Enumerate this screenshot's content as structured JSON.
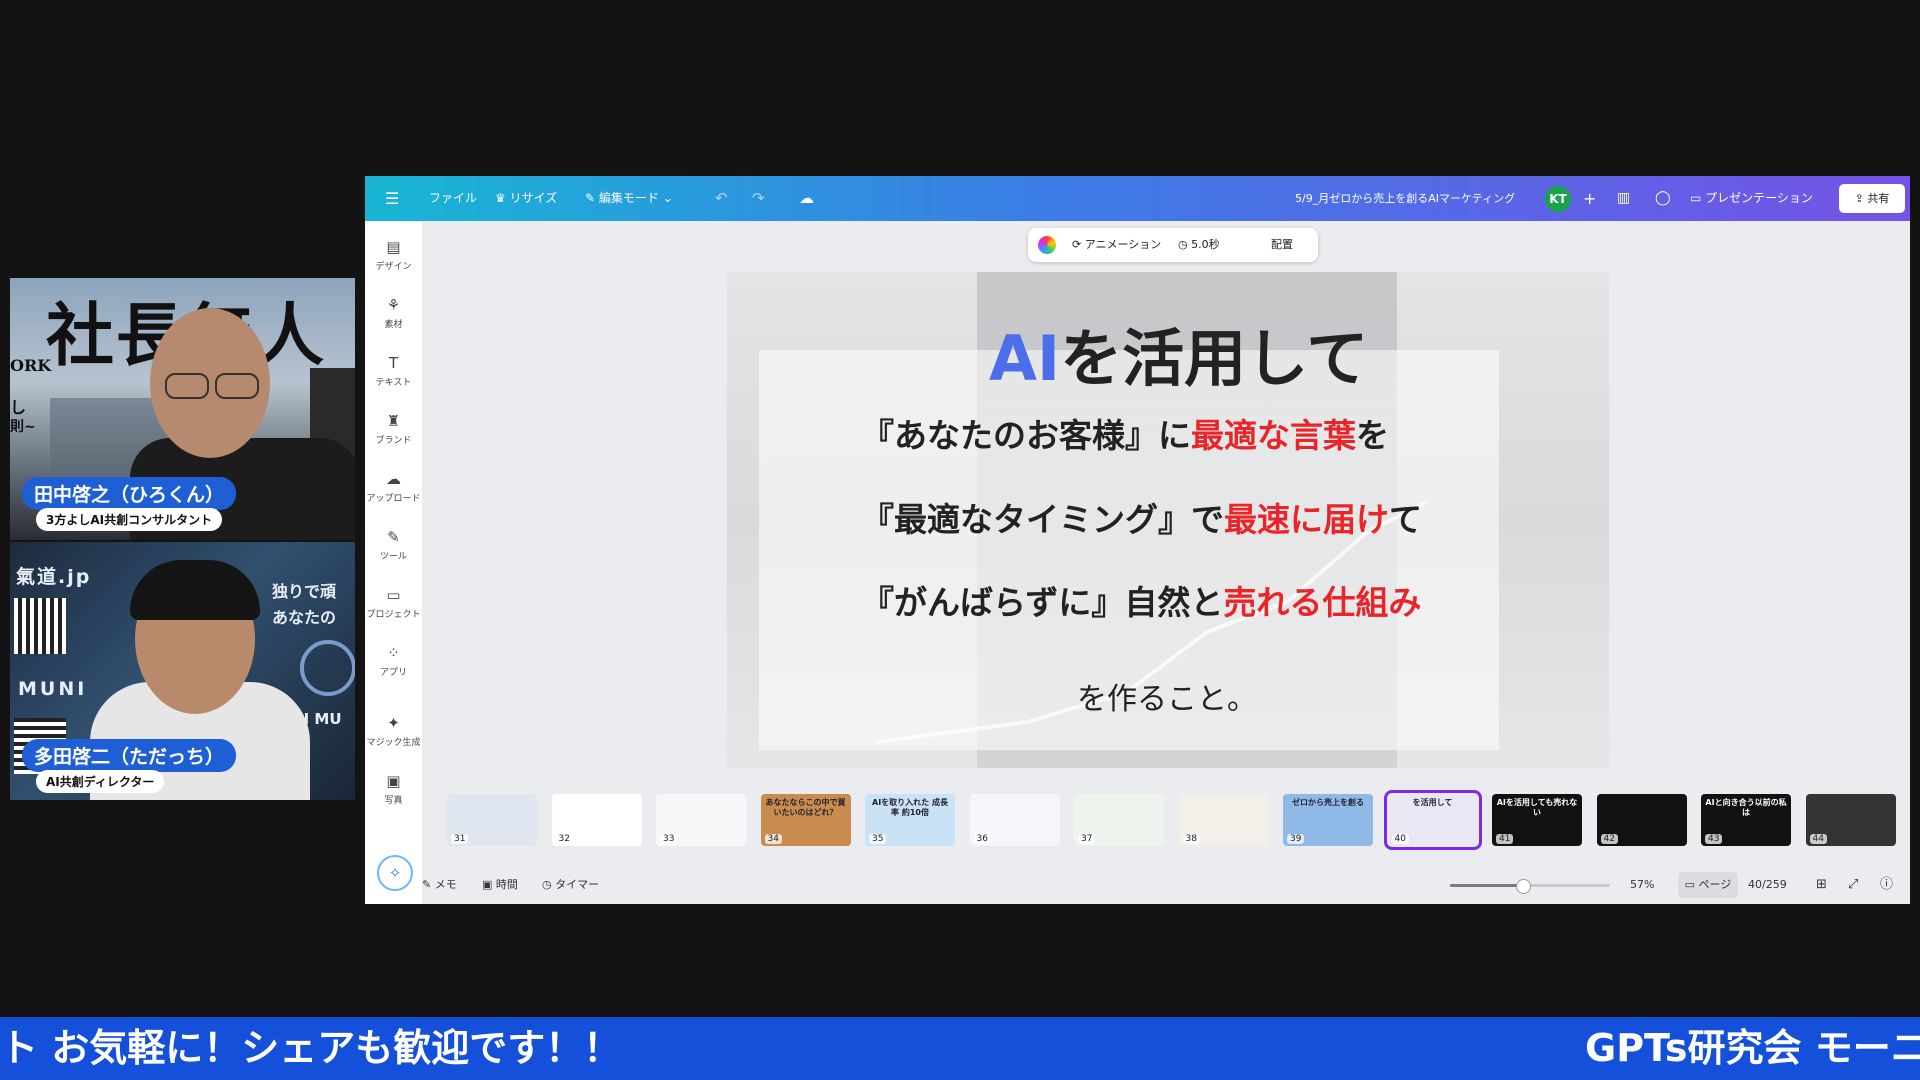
{
  "webcams": [
    {
      "name": "田中啓之（ひろくん）",
      "role": "3方よしAI共創コンサルタント",
      "bg_text_1": "社長無人",
      "bg_text_2": "ORK",
      "bg_text_3": "し",
      "bg_text_4": "則~"
    },
    {
      "name": "多田啓二（ただっち）",
      "role": "AI共創ディレクター",
      "bg_text_1": "氣道.jp",
      "bg_text_2": "独りで頑",
      "bg_text_3": "あなたの",
      "bg_text_4": "MUNI",
      "bg_text_5": "AI MU"
    }
  ],
  "topbar": {
    "menu_icon": "menu-icon",
    "file": "ファイル",
    "resize": "リサイズ",
    "edit_mode": "編集モード",
    "doc_title": "5/9_月ゼロから売上を創るAIマーケティング",
    "avatar": "KT",
    "present": "プレゼンテーション",
    "share": "共有"
  },
  "sidebar": [
    {
      "label": "デザイン",
      "icon": "design-icon",
      "glyph": "▤"
    },
    {
      "label": "素材",
      "icon": "elements-icon",
      "glyph": "⚘"
    },
    {
      "label": "テキスト",
      "icon": "text-icon",
      "glyph": "T"
    },
    {
      "label": "ブランド",
      "icon": "brand-icon",
      "glyph": "♜"
    },
    {
      "label": "アップロード",
      "icon": "upload-icon",
      "glyph": "☁"
    },
    {
      "label": "ツール",
      "icon": "tools-icon",
      "glyph": "✎"
    },
    {
      "label": "プロジェクト",
      "icon": "folder-icon",
      "glyph": "▭"
    },
    {
      "label": "アプリ",
      "icon": "apps-icon",
      "glyph": "⁘"
    },
    {
      "label": "マジック生成",
      "icon": "magic-icon",
      "glyph": "✦"
    },
    {
      "label": "写真",
      "icon": "photo-icon",
      "glyph": "▣"
    }
  ],
  "floatbar": {
    "animation": "アニメーション",
    "duration": "5.0秒",
    "arrange": "配置"
  },
  "slide": {
    "title_ai": "AI",
    "title_rest": "を活用して",
    "line1_a": "『あなたのお客様』に",
    "line1_b": "最適な言葉",
    "line1_c": "を",
    "line2_a": "『最適なタイミング』で",
    "line2_b": "最速に届け",
    "line2_c": "て",
    "line3_a": "『がんばらずに』自然と",
    "line3_b": "売れる仕組み",
    "closing": "を作ること。"
  },
  "thumbnails": [
    {
      "num": "31",
      "bg": "#dfe6ef",
      "label": ""
    },
    {
      "num": "32",
      "bg": "#ffffff",
      "label": ""
    },
    {
      "num": "33",
      "bg": "#f7f7fa",
      "label": ""
    },
    {
      "num": "34",
      "bg": "#c98b4e",
      "label": "あなたならこの中で買いたいのはどれ？"
    },
    {
      "num": "35",
      "bg": "#c9e2f5",
      "label": "AIを取り入れた 成長率 約10倍"
    },
    {
      "num": "36",
      "bg": "#f4f6fa",
      "label": ""
    },
    {
      "num": "37",
      "bg": "#eef3ee",
      "label": ""
    },
    {
      "num": "38",
      "bg": "#f3f0ea",
      "label": ""
    },
    {
      "num": "39",
      "bg": "#8fb9e6",
      "label": "ゼロから売上を創る"
    },
    {
      "num": "40",
      "bg": "#eae6f4",
      "label": "を活用して"
    },
    {
      "num": "41",
      "bg": "#111111",
      "label": "AIを活用しても売れない"
    },
    {
      "num": "42",
      "bg": "#111111",
      "label": ""
    },
    {
      "num": "43",
      "bg": "#111111",
      "label": "AIと向き合う以前の私は"
    },
    {
      "num": "44",
      "bg": "#333333",
      "label": ""
    }
  ],
  "bottombar": {
    "notes": "メモ",
    "duration": "時間",
    "timer": "タイマー",
    "zoom": "57%",
    "zoom_fraction": 0.45,
    "pages": "ページ",
    "page_count": "40/259"
  },
  "ticker": {
    "left": "ト お気軽に！シェアも歓迎です！！",
    "right": "GPTs研究会 モーニ"
  }
}
